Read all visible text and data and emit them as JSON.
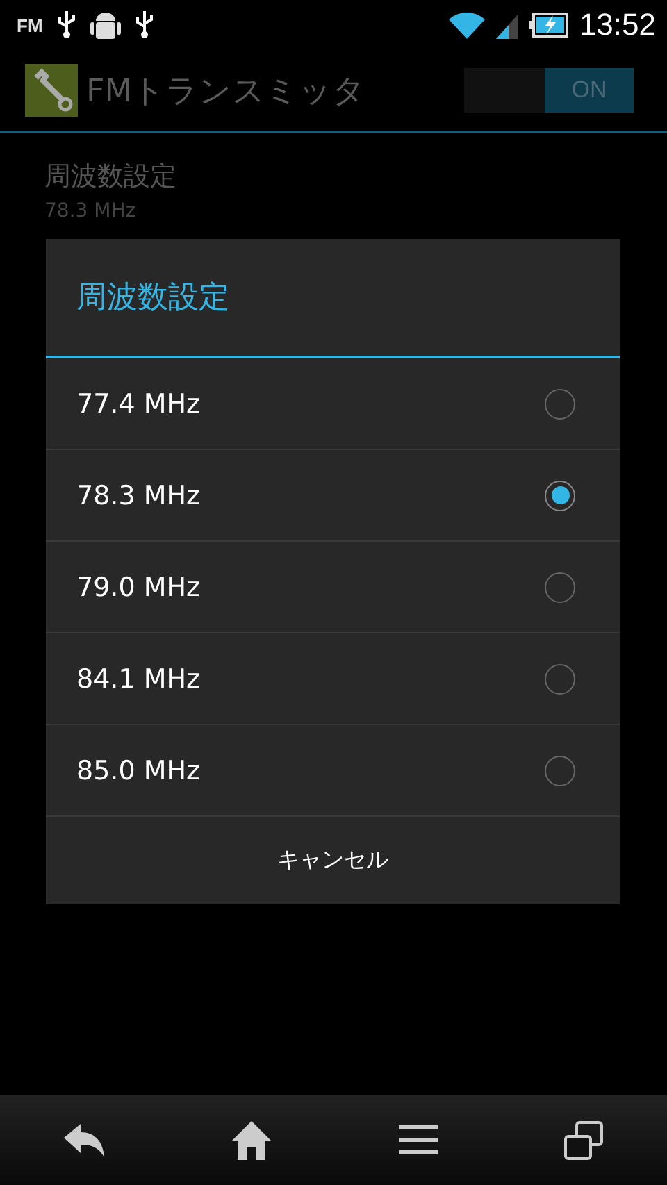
{
  "status_bar": {
    "fm_label": "FM",
    "time": "13:52"
  },
  "action_bar": {
    "title": "FMトランスミッタ",
    "switch": {
      "label": "ON",
      "on": true
    }
  },
  "setting": {
    "title": "周波数設定",
    "summary": "78.3 MHz"
  },
  "dialog": {
    "title": "周波数設定",
    "options": [
      {
        "label": "77.4 MHz",
        "selected": false
      },
      {
        "label": "78.3 MHz",
        "selected": true
      },
      {
        "label": "79.0 MHz",
        "selected": false
      },
      {
        "label": "84.1 MHz",
        "selected": false
      },
      {
        "label": "85.0 MHz",
        "selected": false
      }
    ],
    "cancel": "キャンセル"
  }
}
